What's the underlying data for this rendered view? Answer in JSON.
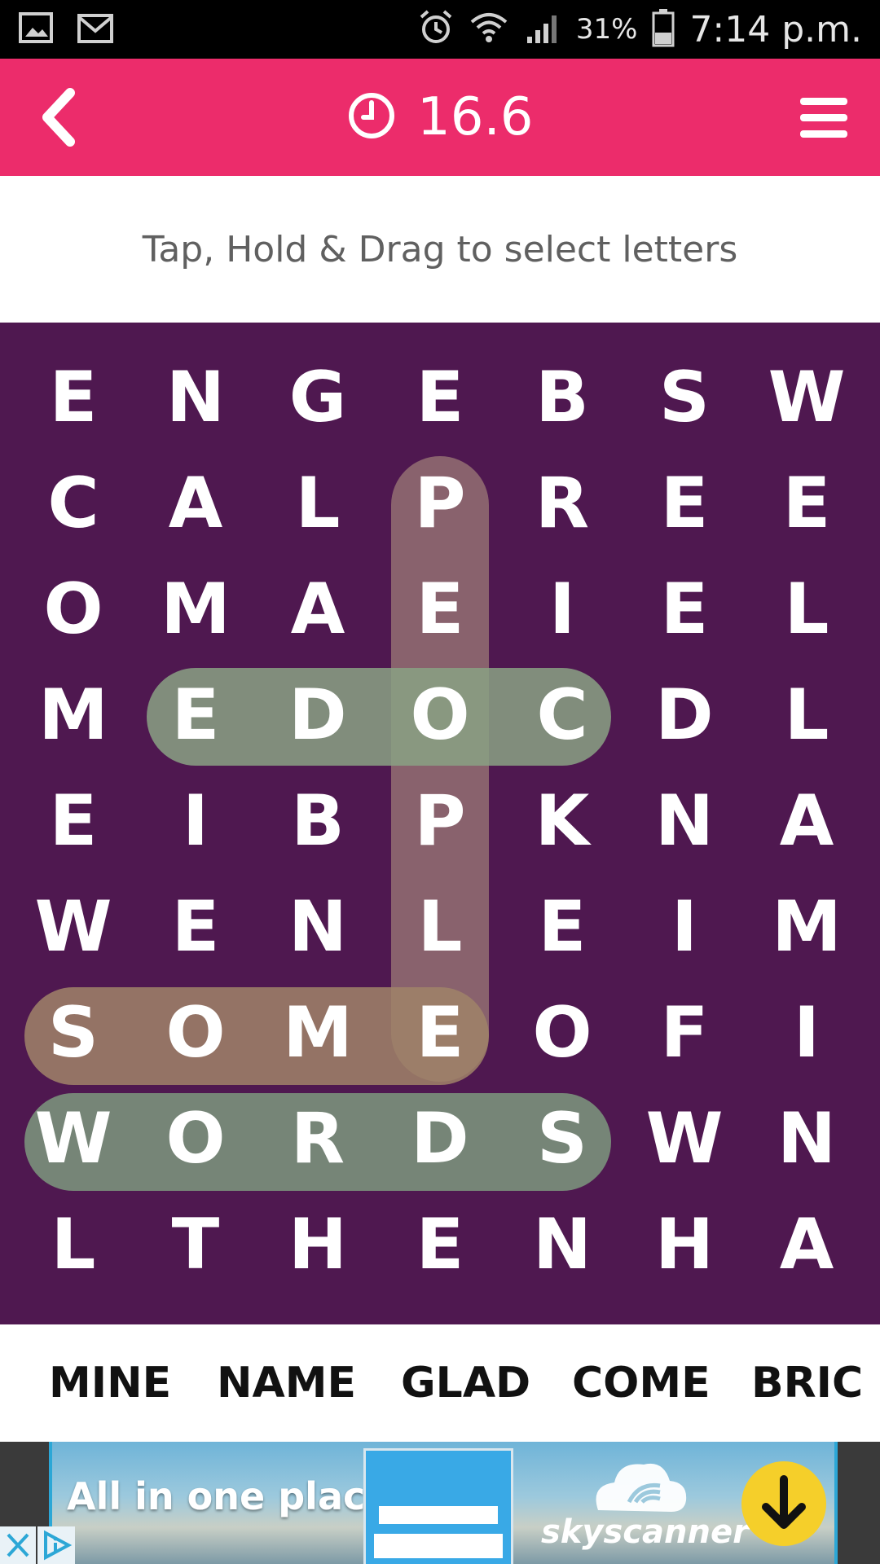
{
  "status_bar": {
    "icons_left": [
      "gallery-icon",
      "gmail-icon"
    ],
    "icons_right": [
      "alarm-icon",
      "wifi-icon",
      "signal-icon",
      "battery-icon"
    ],
    "battery": "31%",
    "time": "7:14 p.m."
  },
  "header": {
    "back_icon": "chevron-left-icon",
    "timer_icon": "clock-icon",
    "timer_value": "16.6",
    "menu_icon": "hamburger-icon",
    "accent_color": "#ec2c6b"
  },
  "instruction": "Tap, Hold & Drag to select letters",
  "board": {
    "background_color": "#4f1850",
    "rows": [
      [
        "E",
        "N",
        "G",
        "E",
        "B",
        "S",
        "W"
      ],
      [
        "C",
        "A",
        "L",
        "P",
        "R",
        "E",
        "E"
      ],
      [
        "O",
        "M",
        "A",
        "E",
        "I",
        "E",
        "L"
      ],
      [
        "M",
        "E",
        "D",
        "O",
        "C",
        "D",
        "L"
      ],
      [
        "E",
        "I",
        "B",
        "P",
        "K",
        "N",
        "A"
      ],
      [
        "W",
        "E",
        "N",
        "L",
        "E",
        "I",
        "M"
      ],
      [
        "S",
        "O",
        "M",
        "E",
        "O",
        "F",
        "I"
      ],
      [
        "W",
        "O",
        "R",
        "D",
        "S",
        "W",
        "N"
      ],
      [
        "L",
        "T",
        "H",
        "E",
        "N",
        "H",
        "A"
      ]
    ],
    "found_words": [
      "PEOPLE",
      "CODE",
      "SOME",
      "WORDS"
    ]
  },
  "word_list": [
    "MINE",
    "NAME",
    "GLAD",
    "COME",
    "BRIC"
  ],
  "ad": {
    "headline": "All in one place.",
    "brand": "skyscanner",
    "download_icon": "arrow-down-icon",
    "close_icon": "close-icon",
    "info_icon": "adchoices-icon"
  }
}
